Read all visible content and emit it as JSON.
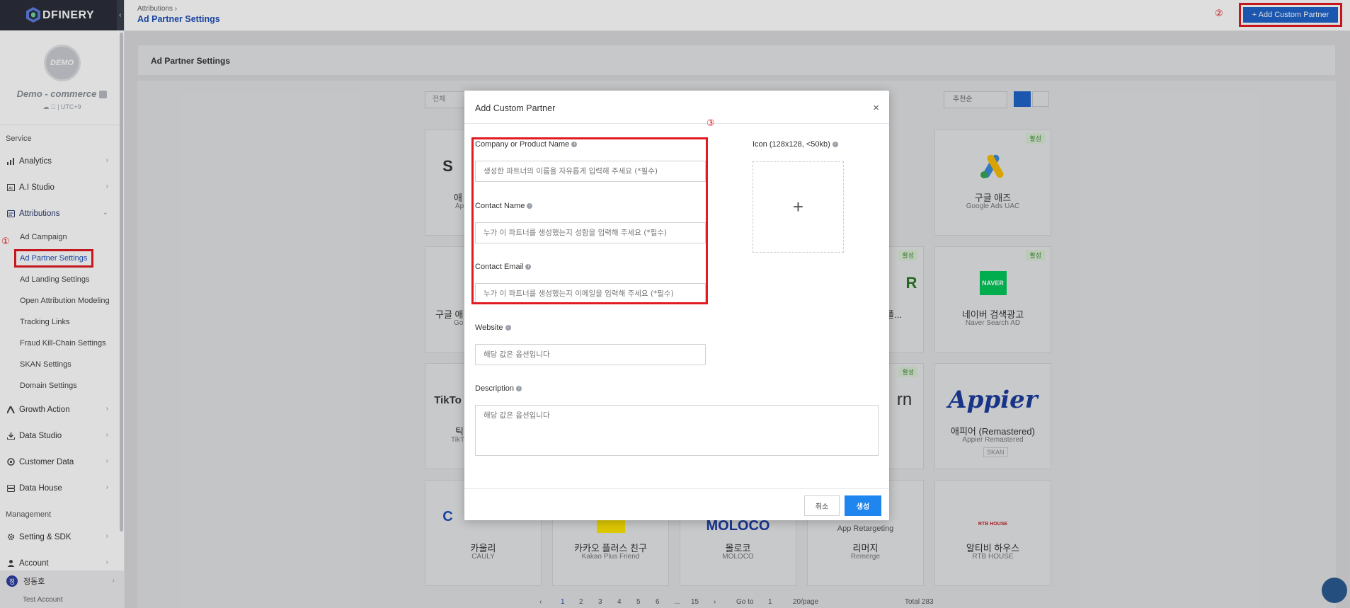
{
  "brand": {
    "name": "DFINERY",
    "accent": "#1f63c9",
    "highlight": "#e01b22"
  },
  "profile": {
    "avatar_text": "DEMO",
    "name": "Demo - commerce",
    "meta": "☁  | UTC+9"
  },
  "sidebar": {
    "section_service": "Service",
    "section_management": "Management",
    "items": [
      {
        "label": "Analytics"
      },
      {
        "label": "A.I Studio"
      },
      {
        "label": "Attributions"
      },
      {
        "label": "Growth Action"
      },
      {
        "label": "Data Studio"
      },
      {
        "label": "Customer Data"
      },
      {
        "label": "Data House"
      },
      {
        "label": "Setting & SDK"
      },
      {
        "label": "Account"
      }
    ],
    "sub_items": [
      {
        "label": "Ad Campaign"
      },
      {
        "label": "Ad Partner Settings"
      },
      {
        "label": "Ad Landing Settings"
      },
      {
        "label": "Open Attribution Modeling"
      },
      {
        "label": "Tracking Links"
      },
      {
        "label": "Fraud Kill-Chain Settings"
      },
      {
        "label": "SKAN Settings"
      },
      {
        "label": "Domain Settings"
      }
    ],
    "user": {
      "initial": "정",
      "name": "정동호"
    },
    "account": "Test Account"
  },
  "markers": {
    "one": "①",
    "two": "②",
    "three": "③"
  },
  "header": {
    "breadcrumb": "Attributions  ›",
    "title": "Ad Partner Settings",
    "add_button": "+ Add Custom Partner"
  },
  "panel": {
    "title": "Ad Partner Settings",
    "filter_placeholder": "전체",
    "sort_value": "추천순"
  },
  "cards": [
    {
      "title": "애",
      "sub": "Ap"
    },
    {
      "title": "구글 애즈",
      "sub": "Google Ads UAC",
      "badge": "활성"
    },
    {
      "title": "구글 애",
      "sub": "Go"
    },
    {
      "title": "...플...",
      "sub": "",
      "badge": "활성"
    },
    {
      "title": "네이버 검색광고",
      "sub": "Naver Search AD",
      "badge": "활성"
    },
    {
      "title": "틱",
      "sub": "TikT"
    },
    {
      "title": "",
      "sub": "",
      "badge": "활성"
    },
    {
      "title": "애피어 (Remastered)",
      "sub": "Appier Remastered",
      "tag": "SKAN"
    },
    {
      "title": "카울리",
      "sub": "CAULY"
    },
    {
      "title": "카카오 플러스 친구",
      "sub": "Kakao Plus Friend"
    },
    {
      "title": "몰로코",
      "sub": "MOLOCO"
    },
    {
      "title": "리머지",
      "sub": "Remerge"
    },
    {
      "title": "알티비 하우스",
      "sub": "RTB HOUSE"
    }
  ],
  "pagination": {
    "pages": [
      "1",
      "2",
      "3",
      "4",
      "5",
      "6",
      "...",
      "15"
    ],
    "goto_label": "Go to",
    "goto_value": "1",
    "page_size": "20/page",
    "total": "Total 283"
  },
  "modal": {
    "title": "Add Custom Partner",
    "close": "×",
    "company_label": "Company or Product Name",
    "company_placeholder": "생성한 파트너의 이름을 자유롭게 입력해 주세요 (*필수)",
    "contact_label": "Contact Name",
    "contact_placeholder": "누가 이 파트너를 생성했는지 성함을 입력해 주세요 (*필수)",
    "email_label": "Contact Email",
    "email_placeholder": "누가 이 파트너를 생성했는지 이메일을 입력해 주세요 (*필수)",
    "website_label": "Website",
    "website_placeholder": "해당 값은 옵션입니다",
    "description_label": "Description",
    "description_placeholder": "해당 값은 옵션입니다",
    "icon_label": "Icon (128x128, <50kb)",
    "upload_plus": "+",
    "cancel": "취소",
    "create": "생성"
  }
}
